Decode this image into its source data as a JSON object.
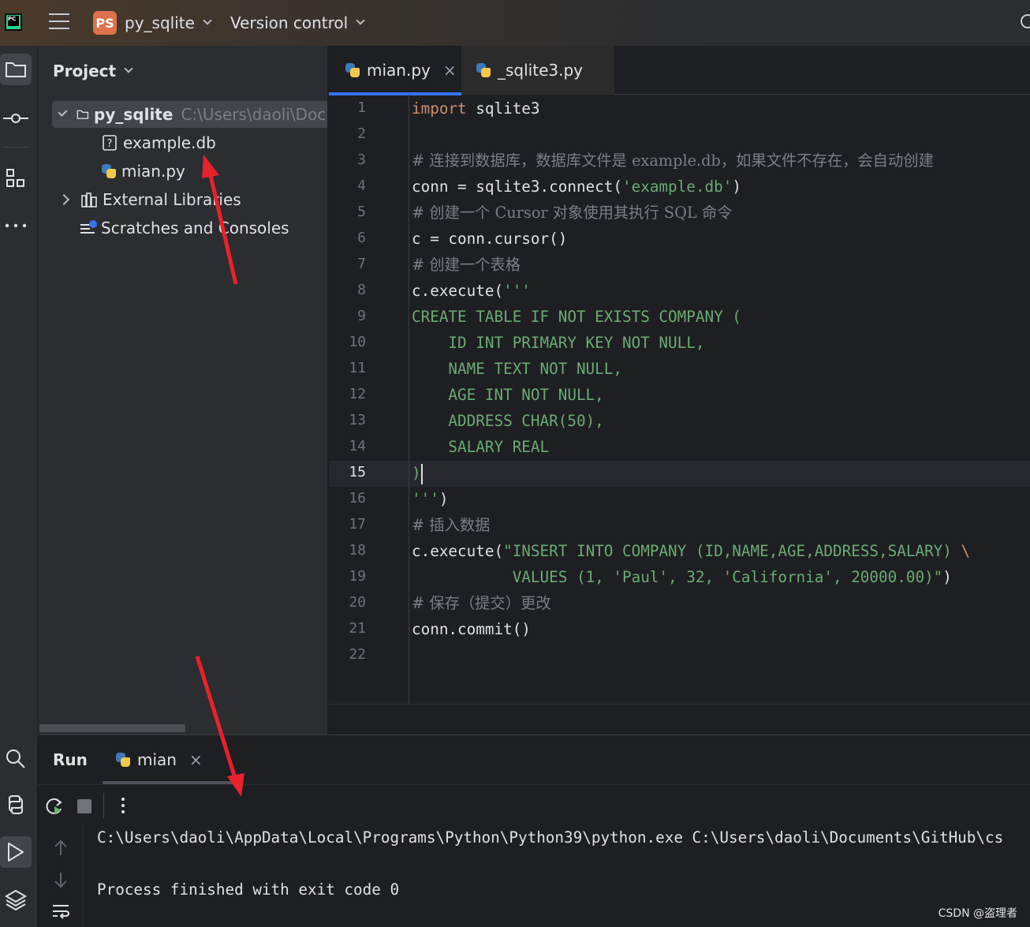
{
  "titlebar": {
    "app_logo_text": "PC",
    "project_badge": "PS",
    "project_name": "py_sqlite",
    "vcs_label": "Version control"
  },
  "project_panel": {
    "title": "Project",
    "tree": [
      {
        "label": "py_sqlite",
        "hint": "C:\\Users\\daoli\\Docu",
        "icon": "folder-icon"
      },
      {
        "label": "example.db",
        "icon": "unknown-file-icon"
      },
      {
        "label": "mian.py",
        "icon": "python-file-icon"
      },
      {
        "label": "External Libraries",
        "icon": "library-icon"
      },
      {
        "label": "Scratches and Consoles",
        "icon": "scratches-icon"
      }
    ]
  },
  "editor": {
    "tabs": [
      {
        "label": "mian.py",
        "active": true
      },
      {
        "label": "_sqlite3.py",
        "active": false
      }
    ],
    "current_line": 15,
    "line_numbers": [
      "1",
      "2",
      "3",
      "4",
      "5",
      "6",
      "7",
      "8",
      "9",
      "10",
      "11",
      "12",
      "13",
      "14",
      "15",
      "16",
      "17",
      "18",
      "19",
      "20",
      "21",
      "22"
    ],
    "code": [
      [
        {
          "t": "kw",
          "v": "import"
        },
        {
          "t": "tx",
          "v": " sqlite3"
        }
      ],
      [],
      [
        {
          "t": "cm",
          "v": "# 连接到数据库，数据库文件是 example.db，如果文件不存在，会自动创建"
        }
      ],
      [
        {
          "t": "tx",
          "v": "conn = sqlite3.connect("
        },
        {
          "t": "st",
          "v": "'example.db'"
        },
        {
          "t": "tx",
          "v": ")"
        }
      ],
      [
        {
          "t": "cm",
          "v": "# 创建一个 Cursor 对象使用其执行 SQL 命令"
        }
      ],
      [
        {
          "t": "tx",
          "v": "c = conn.cursor()"
        }
      ],
      [
        {
          "t": "cm",
          "v": "# 创建一个表格"
        }
      ],
      [
        {
          "t": "tx",
          "v": "c.execute("
        },
        {
          "t": "st",
          "v": "'''"
        }
      ],
      [
        {
          "t": "st",
          "v": "CREATE TABLE IF NOT EXISTS COMPANY ("
        }
      ],
      [
        {
          "t": "st",
          "v": "    ID INT PRIMARY KEY NOT NULL,"
        }
      ],
      [
        {
          "t": "st",
          "v": "    NAME TEXT NOT NULL,"
        }
      ],
      [
        {
          "t": "st",
          "v": "    AGE INT NOT NULL,"
        }
      ],
      [
        {
          "t": "st",
          "v": "    ADDRESS CHAR(50),"
        }
      ],
      [
        {
          "t": "st",
          "v": "    SALARY REAL"
        }
      ],
      [
        {
          "t": "st",
          "v": ")"
        }
      ],
      [
        {
          "t": "st",
          "v": "'''"
        },
        {
          "t": "tx",
          "v": ")"
        }
      ],
      [
        {
          "t": "cm",
          "v": "# 插入数据"
        }
      ],
      [
        {
          "t": "tx",
          "v": "c.execute("
        },
        {
          "t": "st",
          "v": "\"INSERT INTO COMPANY (ID,NAME,AGE,ADDRESS,SALARY) "
        },
        {
          "t": "kw",
          "v": "\\"
        }
      ],
      [
        {
          "t": "st",
          "v": "           VALUES (1, 'Paul', 32, 'California', 20000.00)\""
        },
        {
          "t": "tx",
          "v": ")"
        }
      ],
      [
        {
          "t": "cm",
          "v": "# 保存（提交）更改"
        }
      ],
      [
        {
          "t": "tx",
          "v": "conn.commit()"
        }
      ],
      []
    ]
  },
  "run_panel": {
    "title": "Run",
    "tab_label": "mian",
    "console": [
      "C:\\Users\\daoli\\AppData\\Local\\Programs\\Python\\Python39\\python.exe C:\\Users\\daoli\\Documents\\GitHub\\cs",
      "",
      "Process finished with exit code 0"
    ]
  },
  "watermark": "CSDN @盗理者",
  "colors": {
    "accent": "#3574f0",
    "keyword": "#cf8e6d",
    "string": "#6aab73",
    "comment": "#7a7e85",
    "annotation_arrow": "#e8212b"
  }
}
